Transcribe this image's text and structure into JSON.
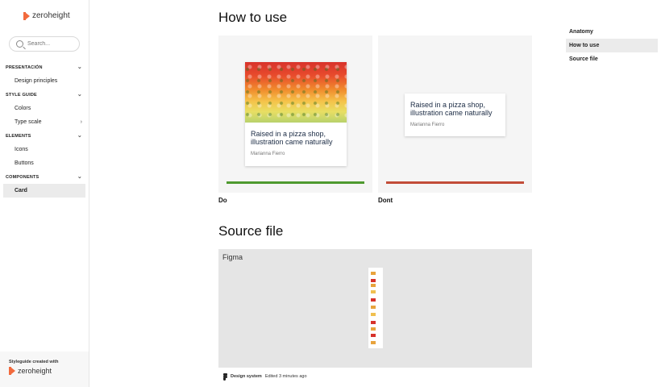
{
  "sidebar": {
    "brand": "zeroheight",
    "search_placeholder": "Search...",
    "sections": [
      {
        "label": "PRESENTACIÓN",
        "items": [
          "Design principles"
        ]
      },
      {
        "label": "STYLE GUIDE",
        "items": [
          "Colors",
          "Type scale"
        ]
      },
      {
        "label": "ELEMENTS",
        "items": [
          "Icons",
          "Buttons"
        ]
      },
      {
        "label": "COMPONENTS",
        "items": [
          "Card"
        ]
      }
    ],
    "active_item": "Card",
    "footer_text": "Styleguide created with",
    "footer_brand": "zeroheight"
  },
  "main": {
    "howto_title": "How to use",
    "do_caption": "Do",
    "dont_caption": "Dont",
    "card_title": "Raised in a pizza shop, illustration came naturally",
    "card_author": "Marianna Fierro",
    "source_title": "Source file",
    "figma_label": "Figma",
    "file_name": "Design system",
    "edited_text": "Edited 3 minutes ago"
  },
  "toc": {
    "items": [
      "Anatomy",
      "How to use",
      "Source file"
    ],
    "active": "How to use"
  },
  "colors": {
    "do_bar": "#4e9a2f",
    "dont_bar": "#c24c38",
    "brand": "#f26a3d"
  }
}
